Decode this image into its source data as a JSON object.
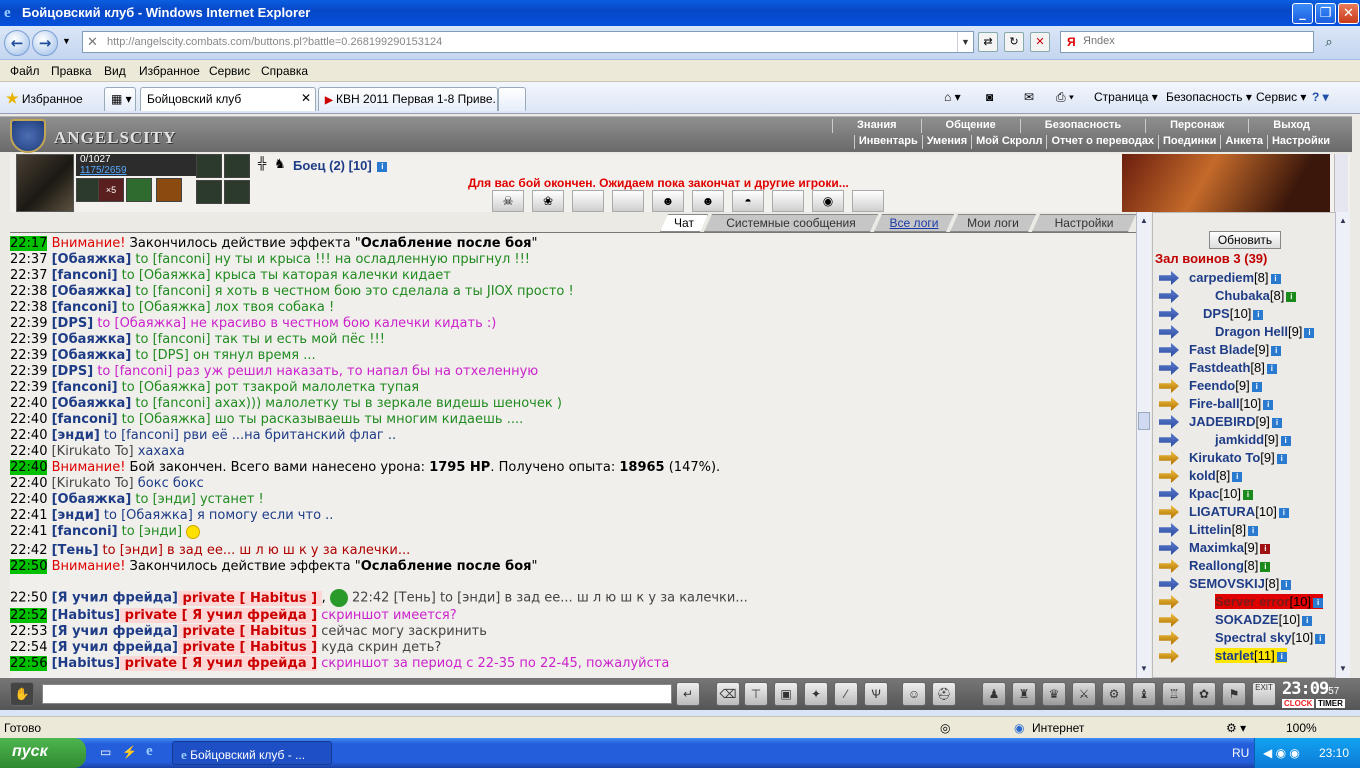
{
  "window": {
    "title": "Бойцовский клуб - Windows Internet Explorer"
  },
  "addressbar": {
    "url": "http://angelscity.combats.com/buttons.pl?battle=0.268199290153124",
    "search_placeholder": "Яndex"
  },
  "menu": [
    "Файл",
    "Правка",
    "Вид",
    "Избранное",
    "Сервис",
    "Справка"
  ],
  "tabsbar": {
    "favorites_label": "Избранное",
    "tabs": [
      "Бойцовский клуб",
      "КВН 2011 Первая 1-8 Приве..."
    ],
    "commands": [
      "Страница",
      "Безопасность",
      "Сервис"
    ]
  },
  "game": {
    "logo": "ANGELSCITY",
    "nav_top": [
      "Знания",
      "Общение",
      "Безопасность",
      "Персонаж",
      "Выход"
    ],
    "nav_bottom": [
      "Инвентарь",
      "Умения",
      "Мой Скролл",
      "Отчет о переводах",
      "Поединки",
      "Анкета",
      "Настройки"
    ],
    "hp": "0/1027",
    "mana": "1175/2659",
    "slot_count": "×5",
    "fighter": "Боец (2) [10]",
    "battle_message": "Для вас бой окончен. Ожидаем пока закончат и другие игроки...",
    "chat_tabs": [
      "Чат",
      "Системные сообщения",
      "Все логи",
      "Мои логи",
      "Настройки"
    ],
    "chat": [
      {
        "time": "22:17",
        "hl": true,
        "parts": [
          {
            "c": "sys",
            "t": "Внимание! "
          },
          {
            "c": "t",
            "t": "Закончилось действие эффекта \""
          },
          {
            "c": "b",
            "t": "Ослабление после боя"
          },
          {
            "c": "t",
            "t": "\""
          }
        ]
      },
      {
        "time": "22:37",
        "parts": [
          {
            "c": "nick",
            "t": "[Обаяжка]"
          },
          {
            "c": "grn",
            "t": " to [fanconi] ну ты и крыса !!! на осладленную прыгнул !!!"
          }
        ]
      },
      {
        "time": "22:37",
        "parts": [
          {
            "c": "nick",
            "t": "[fanconi]"
          },
          {
            "c": "grn",
            "t": " to [Обаяжка] крыса ты каторая калечки кидает"
          }
        ]
      },
      {
        "time": "22:38",
        "parts": [
          {
            "c": "nick",
            "t": "[Обаяжка]"
          },
          {
            "c": "grn",
            "t": " to [fanconi] я хоть в честном бою это сделала а ты JIOX просто !"
          }
        ]
      },
      {
        "time": "22:38",
        "parts": [
          {
            "c": "nick",
            "t": "[fanconi]"
          },
          {
            "c": "grn",
            "t": " to [Обаяжка] лох твоя собака !"
          }
        ]
      },
      {
        "time": "22:39",
        "parts": [
          {
            "c": "nick",
            "t": "[DPS]"
          },
          {
            "c": "pnk",
            "t": " to [Обаяжка] не красиво в честном бою калечки кидать :)"
          }
        ]
      },
      {
        "time": "22:39",
        "parts": [
          {
            "c": "nick",
            "t": "[Обаяжка]"
          },
          {
            "c": "grn",
            "t": " to [fanconi] так ты и есть мой пёс !!!"
          }
        ]
      },
      {
        "time": "22:39",
        "parts": [
          {
            "c": "nick",
            "t": "[Обаяжка]"
          },
          {
            "c": "grn",
            "t": " to [DPS] он тянул время ..."
          }
        ]
      },
      {
        "time": "22:39",
        "parts": [
          {
            "c": "nick",
            "t": "[DPS]"
          },
          {
            "c": "pnk",
            "t": " to [fanconi] раз уж решил наказать, то напал бы на отхеленную"
          }
        ]
      },
      {
        "time": "22:39",
        "parts": [
          {
            "c": "nick",
            "t": "[fanconi]"
          },
          {
            "c": "grn",
            "t": " to [Обаяжка] рот тзакрой малолетка тупая"
          }
        ]
      },
      {
        "time": "22:40",
        "parts": [
          {
            "c": "nick",
            "t": "[Обаяжка]"
          },
          {
            "c": "grn",
            "t": " to [fanconi] ахах))) малолетку ты в зеркале видешь шеночек )"
          }
        ]
      },
      {
        "time": "22:40",
        "parts": [
          {
            "c": "nick",
            "t": "[fanconi]"
          },
          {
            "c": "grn",
            "t": " to [Обаяжка] шо ты расказываешь ты многим кидаешь ...."
          }
        ]
      },
      {
        "time": "22:40",
        "parts": [
          {
            "c": "nick",
            "t": "[энди]"
          },
          {
            "c": "blu",
            "t": " to [fanconi] рви её ...на британский флаг .."
          }
        ]
      },
      {
        "time": "22:40",
        "parts": [
          {
            "c": "gry",
            "t": "[Kirukato To]"
          },
          {
            "c": "blu",
            "t": " хахаха"
          }
        ]
      },
      {
        "time": "22:40",
        "hl": true,
        "parts": [
          {
            "c": "sys",
            "t": "Внимание! "
          },
          {
            "c": "t",
            "t": "Бой закончен. Всего вами нанесено урона: "
          },
          {
            "c": "b",
            "t": "1795 HP"
          },
          {
            "c": "t",
            "t": ". Получено опыта: "
          },
          {
            "c": "b",
            "t": "18965"
          },
          {
            "c": "t",
            "t": " (147%)."
          }
        ]
      },
      {
        "time": "22:40",
        "parts": [
          {
            "c": "gry",
            "t": "[Kirukato To]"
          },
          {
            "c": "blu",
            "t": " бокс бокс"
          }
        ]
      },
      {
        "time": "22:40",
        "parts": [
          {
            "c": "nick",
            "t": "[Обаяжка]"
          },
          {
            "c": "grn",
            "t": " to [энди] устанет !"
          }
        ]
      },
      {
        "time": "22:41",
        "parts": [
          {
            "c": "nick",
            "t": "[энди]"
          },
          {
            "c": "blu",
            "t": " to [Обаяжка] я помогу если что .."
          }
        ]
      },
      {
        "time": "22:41",
        "smile": true,
        "parts": [
          {
            "c": "nick",
            "t": "[fanconi]"
          },
          {
            "c": "grn",
            "t": " to [энди] "
          }
        ]
      },
      {
        "time": "22:42",
        "parts": [
          {
            "c": "nick",
            "t": "[Тень]"
          },
          {
            "c": "red",
            "t": " to [энди] в зад ее... ш л ю ш к у за калечки..."
          }
        ]
      },
      {
        "time": "22:50",
        "hl": true,
        "parts": [
          {
            "c": "sys",
            "t": "Внимание! "
          },
          {
            "c": "t",
            "t": "Закончилось действие эффекта \""
          },
          {
            "c": "b",
            "t": "Ослабление после боя"
          },
          {
            "c": "t",
            "t": "\""
          }
        ]
      },
      {
        "time": "22:50",
        "smile2": true,
        "parts": [
          {
            "c": "nick",
            "t": "[Я учил фрейда]"
          },
          {
            "c": "priv",
            "t": " private [ Habitus ] "
          },
          {
            "c": "t",
            "t": ", "
          },
          {
            "c": "gry",
            "t": " 22:42 [Тень] to [энди] в зад ее... ш л ю ш к у за калечки..."
          }
        ]
      },
      {
        "time": "22:52",
        "hl": true,
        "parts": [
          {
            "c": "nick",
            "t": "[Habitus]"
          },
          {
            "c": "priv",
            "t": " private [ Я учил фрейда ]"
          },
          {
            "c": "pnk",
            "t": " скриншот имеется?"
          }
        ]
      },
      {
        "time": "22:53",
        "parts": [
          {
            "c": "nick",
            "t": "[Я учил фрейда]"
          },
          {
            "c": "priv",
            "t": " private [ Habitus ]"
          },
          {
            "c": "gry",
            "t": " сейчас могу заскринить"
          }
        ]
      },
      {
        "time": "22:54",
        "parts": [
          {
            "c": "nick",
            "t": "[Я учил фрейда]"
          },
          {
            "c": "priv",
            "t": " private [ Habitus ]"
          },
          {
            "c": "gry",
            "t": " куда скрин деть?"
          }
        ]
      },
      {
        "time": "22:56",
        "hl": true,
        "parts": [
          {
            "c": "nick",
            "t": "[Habitus]"
          },
          {
            "c": "priv",
            "t": " private [ Я учил фрейда ]"
          },
          {
            "c": "pnk",
            "t": " скриншот за период с 22-35 по 22-45, пожалуйста"
          }
        ]
      }
    ],
    "room": {
      "refresh_label": "Обновить",
      "title": "Зал воинов 3 (39)",
      "players": [
        {
          "name": "carpediem",
          "lvl": "[8]"
        },
        {
          "name": "Chubaka",
          "lvl": "[8]"
        },
        {
          "name": "DPS",
          "lvl": "[10]"
        },
        {
          "name": "Dragon Hell",
          "lvl": "[9]"
        },
        {
          "name": "Fast Blade",
          "lvl": "[9]"
        },
        {
          "name": "Fastdeath",
          "lvl": "[8]"
        },
        {
          "name": "Feendo",
          "lvl": "[9]"
        },
        {
          "name": "Fire-ball",
          "lvl": "[10]"
        },
        {
          "name": "JADEBIRD",
          "lvl": "[9]"
        },
        {
          "name": "jamkidd",
          "lvl": "[9]"
        },
        {
          "name": "Kirukato To",
          "lvl": "[9]"
        },
        {
          "name": "kold",
          "lvl": "[8]"
        },
        {
          "name": "Крас",
          "lvl": "[10]"
        },
        {
          "name": "LIGATURA",
          "lvl": "[10]"
        },
        {
          "name": "Littelin",
          "lvl": "[8]"
        },
        {
          "name": "Maximka",
          "lvl": "[9]"
        },
        {
          "name": "Reallong",
          "lvl": "[8]"
        },
        {
          "name": "SEMOVSKIJ",
          "lvl": "[8]"
        },
        {
          "name": "Server error",
          "lvl": "[10]"
        },
        {
          "name": "SOKADZE",
          "lvl": "[10]"
        },
        {
          "name": "Spectral sky",
          "lvl": "[10]"
        },
        {
          "name": "starlet",
          "lvl": "[11]"
        }
      ]
    },
    "clock": {
      "time": "23:09",
      "seconds": "57",
      "clock_label": "CLOCK",
      "timer_label": "TIMER"
    }
  },
  "statusbar": {
    "left": "Готово",
    "zone": "Интернет",
    "zoom": "100%"
  },
  "taskbar": {
    "start": "пуск",
    "item": "Бойцовский клуб - ...",
    "lang": "RU",
    "time": "23:10"
  }
}
